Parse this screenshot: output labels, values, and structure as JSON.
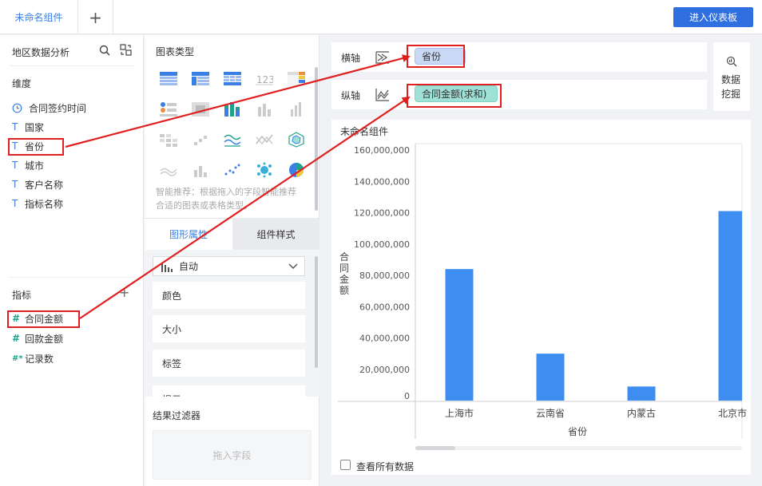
{
  "tabs": {
    "active_label": "未命名组件",
    "add_label": "+"
  },
  "header": {
    "enter_dashboard": "进入仪表板"
  },
  "left_panel": {
    "dataset": "地区数据分析",
    "dimension_label": "维度",
    "dimensions": [
      {
        "type_icon": "clock-icon",
        "label": "合同签约时间"
      },
      {
        "type_icon": "T",
        "label": "国家"
      },
      {
        "type_icon": "T",
        "label": "省份"
      },
      {
        "type_icon": "T",
        "label": "城市"
      },
      {
        "type_icon": "T",
        "label": "客户名称"
      },
      {
        "type_icon": "T",
        "label": "指标名称"
      }
    ],
    "measure_label": "指标",
    "measure_add": "+",
    "measures": [
      {
        "type_icon": "#",
        "label": "合同金额"
      },
      {
        "type_icon": "#",
        "label": "回款金额"
      },
      {
        "type_icon": "#*",
        "label": "记录数"
      }
    ]
  },
  "middle_panel": {
    "chart_types_title": "图表类型",
    "hint": "智能推荐：根据拖入的字段智能推荐合适的图表或表格类型。",
    "tab_graphic": "图形属性",
    "tab_style": "组件样式",
    "auto_select": "自动",
    "props": [
      "颜色",
      "大小",
      "标签",
      "提示"
    ],
    "filter_title": "结果过滤器",
    "filter_placeholder": "拖入字段"
  },
  "right_panel": {
    "x_axis_label": "横轴",
    "y_axis_label": "纵轴",
    "x_field": "省份",
    "y_field": "合同金额(求和)",
    "data_mining": "数据挖掘",
    "view_all": "查看所有数据"
  },
  "colors": {
    "accent": "#2f6fe0",
    "bar": "#3d8ef0",
    "highlight": "#e02020",
    "teal_pill": "#9fe1d6",
    "blue_pill": "#c9d8f5"
  },
  "chart_data": {
    "type": "bar",
    "title": "未命名组件",
    "xlabel": "省份",
    "ylabel": "合同金额",
    "categories": [
      "上海市",
      "云南省",
      "内蒙古",
      "北京市"
    ],
    "values": [
      84000000,
      30000000,
      9000000,
      121000000
    ],
    "ylim": [
      0,
      160000000
    ],
    "yticks": [
      "0",
      "20,000,000",
      "40,000,000",
      "60,000,000",
      "80,000,000",
      "100,000,000",
      "120,000,000",
      "140,000,000",
      "160,000,000"
    ],
    "grid": false,
    "legend": "none"
  }
}
